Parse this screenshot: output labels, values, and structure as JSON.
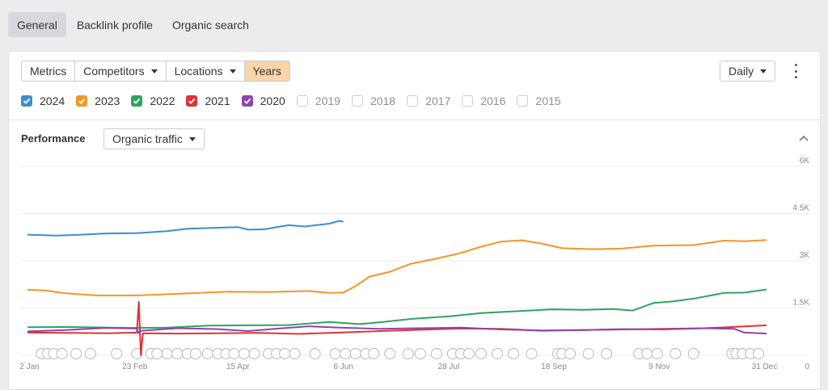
{
  "nav": {
    "tabs": [
      {
        "label": "General",
        "active": true
      },
      {
        "label": "Backlink profile",
        "active": false
      },
      {
        "label": "Organic search",
        "active": false
      }
    ]
  },
  "toolbar": {
    "metrics": "Metrics",
    "competitors": "Competitors",
    "locations": "Locations",
    "years": "Years",
    "interval": "Daily"
  },
  "year_filters": [
    {
      "label": "2024",
      "checked": true,
      "color": "#3d8bd4"
    },
    {
      "label": "2023",
      "checked": true,
      "color": "#f39625"
    },
    {
      "label": "2022",
      "checked": true,
      "color": "#2ea361"
    },
    {
      "label": "2021",
      "checked": true,
      "color": "#dd3333"
    },
    {
      "label": "2020",
      "checked": true,
      "color": "#8e44ad"
    },
    {
      "label": "2019",
      "checked": false
    },
    {
      "label": "2018",
      "checked": false
    },
    {
      "label": "2017",
      "checked": false
    },
    {
      "label": "2016",
      "checked": false
    },
    {
      "label": "2015",
      "checked": false
    }
  ],
  "performance": {
    "title": "Performance",
    "metric": "Organic traffic"
  },
  "chart_data": {
    "type": "line",
    "x_ticks": [
      "2 Jan",
      "23 Feb",
      "15 Apr",
      "6 Jun",
      "28 Jul",
      "18 Sep",
      "9 Nov",
      "31 Dec"
    ],
    "x_tick_days": [
      2,
      54,
      105,
      157,
      209,
      261,
      313,
      365
    ],
    "y_ticks": [
      "6K",
      "4.5K",
      "3K",
      "1.5K",
      "0"
    ],
    "ylim": [
      0,
      6000
    ],
    "xlim": [
      1,
      366
    ],
    "grid": true,
    "series": [
      {
        "name": "2024",
        "color": "#3d8bd4",
        "points": [
          [
            1,
            3830
          ],
          [
            15,
            3800
          ],
          [
            25,
            3820
          ],
          [
            40,
            3870
          ],
          [
            55,
            3880
          ],
          [
            70,
            3940
          ],
          [
            80,
            4020
          ],
          [
            95,
            4050
          ],
          [
            105,
            4070
          ],
          [
            110,
            3990
          ],
          [
            118,
            4000
          ],
          [
            125,
            4080
          ],
          [
            130,
            4130
          ],
          [
            138,
            4090
          ],
          [
            150,
            4180
          ],
          [
            155,
            4270
          ],
          [
            157,
            4240
          ]
        ]
      },
      {
        "name": "2023",
        "color": "#f39625",
        "points": [
          [
            1,
            2080
          ],
          [
            10,
            2060
          ],
          [
            20,
            1970
          ],
          [
            35,
            1900
          ],
          [
            55,
            1900
          ],
          [
            75,
            1950
          ],
          [
            100,
            2020
          ],
          [
            120,
            2010
          ],
          [
            140,
            2040
          ],
          [
            150,
            1980
          ],
          [
            157,
            1990
          ],
          [
            163,
            2200
          ],
          [
            170,
            2500
          ],
          [
            180,
            2650
          ],
          [
            190,
            2900
          ],
          [
            205,
            3100
          ],
          [
            215,
            3250
          ],
          [
            225,
            3450
          ],
          [
            235,
            3610
          ],
          [
            245,
            3650
          ],
          [
            255,
            3550
          ],
          [
            265,
            3400
          ],
          [
            280,
            3370
          ],
          [
            295,
            3390
          ],
          [
            310,
            3480
          ],
          [
            330,
            3500
          ],
          [
            345,
            3640
          ],
          [
            355,
            3620
          ],
          [
            366,
            3660
          ]
        ]
      },
      {
        "name": "2022",
        "color": "#2ea361",
        "points": [
          [
            1,
            890
          ],
          [
            20,
            900
          ],
          [
            40,
            880
          ],
          [
            55,
            870
          ],
          [
            70,
            880
          ],
          [
            90,
            940
          ],
          [
            110,
            950
          ],
          [
            130,
            960
          ],
          [
            150,
            1060
          ],
          [
            165,
            990
          ],
          [
            175,
            1050
          ],
          [
            190,
            1150
          ],
          [
            210,
            1240
          ],
          [
            225,
            1340
          ],
          [
            240,
            1390
          ],
          [
            260,
            1460
          ],
          [
            275,
            1440
          ],
          [
            290,
            1470
          ],
          [
            300,
            1420
          ],
          [
            310,
            1660
          ],
          [
            320,
            1710
          ],
          [
            330,
            1800
          ],
          [
            345,
            1980
          ],
          [
            355,
            1990
          ],
          [
            366,
            2090
          ]
        ]
      },
      {
        "name": "2021",
        "color": "#dd3333",
        "points": [
          [
            1,
            720
          ],
          [
            20,
            710
          ],
          [
            40,
            700
          ],
          [
            55,
            720
          ],
          [
            56,
            1700
          ],
          [
            57,
            10
          ],
          [
            58,
            700
          ],
          [
            75,
            690
          ],
          [
            95,
            700
          ],
          [
            115,
            710
          ],
          [
            135,
            680
          ],
          [
            155,
            720
          ],
          [
            175,
            770
          ],
          [
            195,
            810
          ],
          [
            215,
            850
          ],
          [
            235,
            840
          ],
          [
            255,
            780
          ],
          [
            275,
            800
          ],
          [
            295,
            820
          ],
          [
            315,
            840
          ],
          [
            335,
            860
          ],
          [
            350,
            900
          ],
          [
            366,
            950
          ]
        ]
      },
      {
        "name": "2020",
        "color": "#8e44ad",
        "points": [
          [
            1,
            760
          ],
          [
            20,
            800
          ],
          [
            40,
            870
          ],
          [
            55,
            850
          ],
          [
            56,
            700
          ],
          [
            57,
            780
          ],
          [
            75,
            860
          ],
          [
            95,
            830
          ],
          [
            110,
            770
          ],
          [
            125,
            850
          ],
          [
            140,
            920
          ],
          [
            155,
            880
          ],
          [
            175,
            840
          ],
          [
            195,
            860
          ],
          [
            215,
            880
          ],
          [
            235,
            820
          ],
          [
            255,
            790
          ],
          [
            275,
            800
          ],
          [
            295,
            830
          ],
          [
            315,
            820
          ],
          [
            335,
            860
          ],
          [
            350,
            840
          ],
          [
            355,
            720
          ],
          [
            366,
            690
          ]
        ]
      }
    ],
    "annotation_days": [
      8,
      11,
      14,
      18,
      25,
      32,
      45,
      55,
      62,
      65,
      70,
      75,
      80,
      84,
      90,
      95,
      99,
      103,
      108,
      113,
      120,
      124,
      128,
      133,
      143,
      153,
      158,
      163,
      168,
      172,
      180,
      189,
      195,
      203,
      211,
      215,
      219,
      225,
      233,
      241,
      250,
      263,
      265,
      269,
      278,
      287,
      303,
      307,
      312,
      321,
      330,
      349,
      351,
      354,
      358,
      362
    ]
  }
}
